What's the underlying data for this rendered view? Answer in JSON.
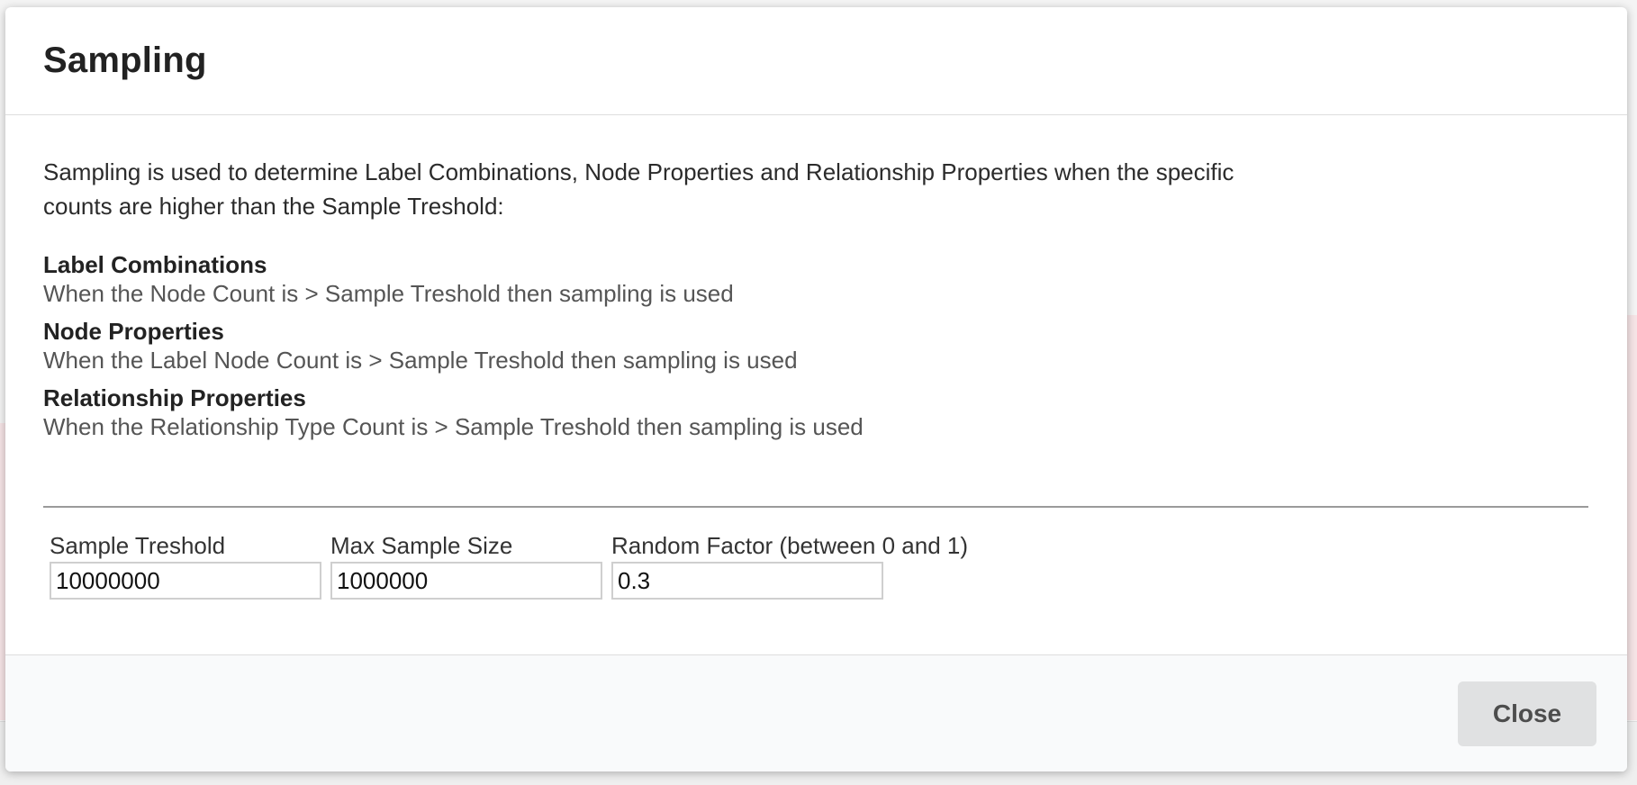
{
  "modal": {
    "title": "Sampling",
    "intro": "Sampling is used to determine Label Combinations, Node Properties and Relationship Properties when the specific counts are higher than the Sample Treshold:",
    "rules": [
      {
        "title": "Label Combinations",
        "description": "When the Node Count is > Sample Treshold then sampling is used"
      },
      {
        "title": "Node Properties",
        "description": "When the Label Node Count is > Sample Treshold then sampling is used"
      },
      {
        "title": "Relationship Properties",
        "description": "When the Relationship Type Count is > Sample Treshold then sampling is used"
      }
    ],
    "fields": [
      {
        "label": "Sample Treshold",
        "value": "10000000"
      },
      {
        "label": "Max Sample Size",
        "value": "1000000"
      },
      {
        "label": "Random Factor (between 0 and 1)",
        "value": "0.3"
      }
    ],
    "close_label": "Close"
  },
  "colors": {
    "modal_background": "#ffffff",
    "footer_background": "#f9fafb",
    "button_background": "#e0e1e2",
    "backdrop": "#e6e6e6"
  }
}
